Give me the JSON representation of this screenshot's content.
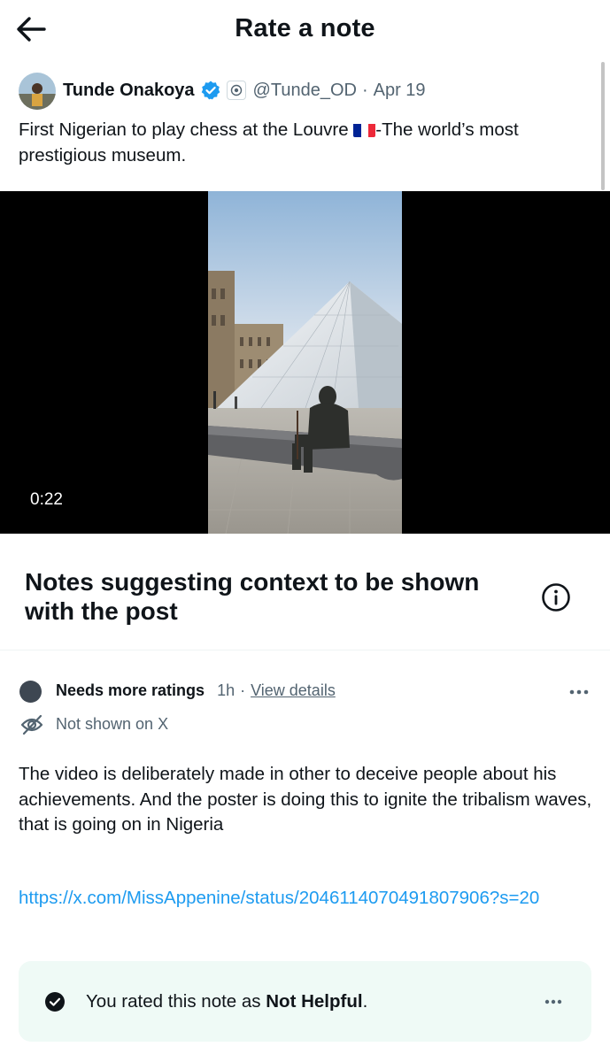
{
  "header": {
    "title": "Rate a note",
    "back_icon": "arrow-left-icon"
  },
  "post": {
    "author_name": "Tunde Onakoya",
    "handle": "@Tunde_OD",
    "separator": "·",
    "date": "Apr 19",
    "verified_color": "#1d9bf0",
    "text_before_flag": "First Nigerian to play chess at the Louvre ",
    "text_after_flag": "-The world’s most prestigious museum.",
    "flag_colors": [
      "#002395",
      "#ffffff",
      "#ed2939"
    ]
  },
  "video": {
    "time": "0:22"
  },
  "notes_section": {
    "title": "Notes suggesting context to be shown with the post",
    "info_icon": "info-circle-icon"
  },
  "note": {
    "status": "Needs more ratings",
    "age": "1h",
    "separator": "·",
    "view_details": "View details",
    "visibility": "Not shown on X",
    "body": "The video is deliberately made in other to deceive people about his achievements.  And the poster is doing this to ignite the tribalism waves, that is going on in Nigeria",
    "link": "https://x.com/MissAppenine/status/2046114070491807906?s=20"
  },
  "rating": {
    "prefix": "You rated this note as ",
    "value": "Not Helpful",
    "suffix": ".",
    "background": "#effaf6"
  },
  "colors": {
    "link": "#1d9bf0",
    "secondary_text": "#536471",
    "status_dot": "#3e4752"
  }
}
